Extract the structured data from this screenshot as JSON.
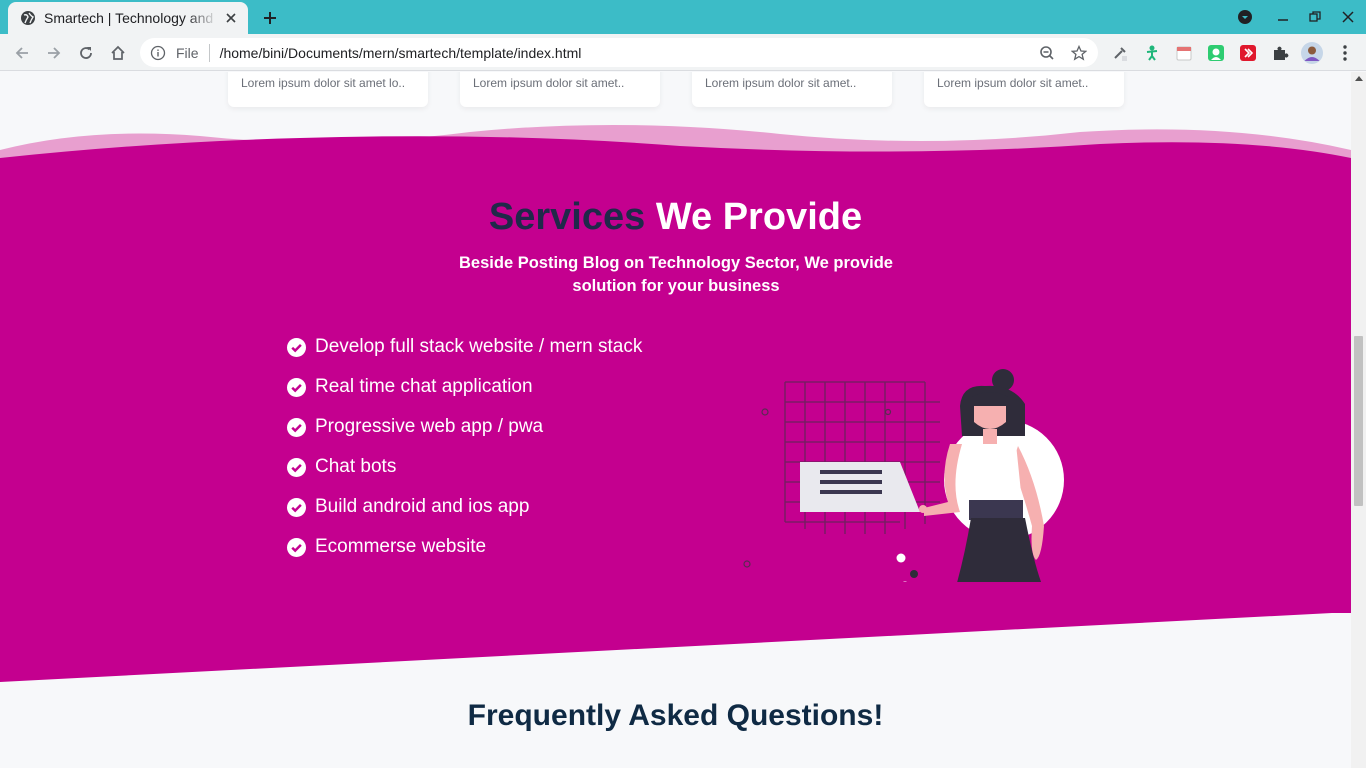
{
  "browser": {
    "tab_title": "Smartech | Technology and Blog",
    "url_scheme": "File",
    "url_path": "/home/bini/Documents/mern/smartech/template/index.html"
  },
  "cards": [
    {
      "text": "Lorem ipsum dolor sit amet lo.."
    },
    {
      "text": "Lorem ipsum dolor sit amet.."
    },
    {
      "text": "Lorem ipsum dolor sit amet.."
    },
    {
      "text": "Lorem ipsum dolor sit amet.."
    }
  ],
  "services": {
    "title_part1": "Services",
    "title_part2": " We Provide",
    "subtitle": "Beside Posting Blog on Technology Sector, We provide solution for your business",
    "items": [
      "Develop full stack website / mern stack",
      "Real time chat application",
      "Progressive web app / pwa",
      "Chat bots",
      "Build android and ios app",
      "Ecommerse website"
    ]
  },
  "faq": {
    "title": "Frequently Asked Questions!"
  },
  "colors": {
    "tabbar": "#3cbcc7",
    "services_bg": "#c4008f",
    "title_dark": "#20294a",
    "faq_title": "#0f2a44"
  }
}
